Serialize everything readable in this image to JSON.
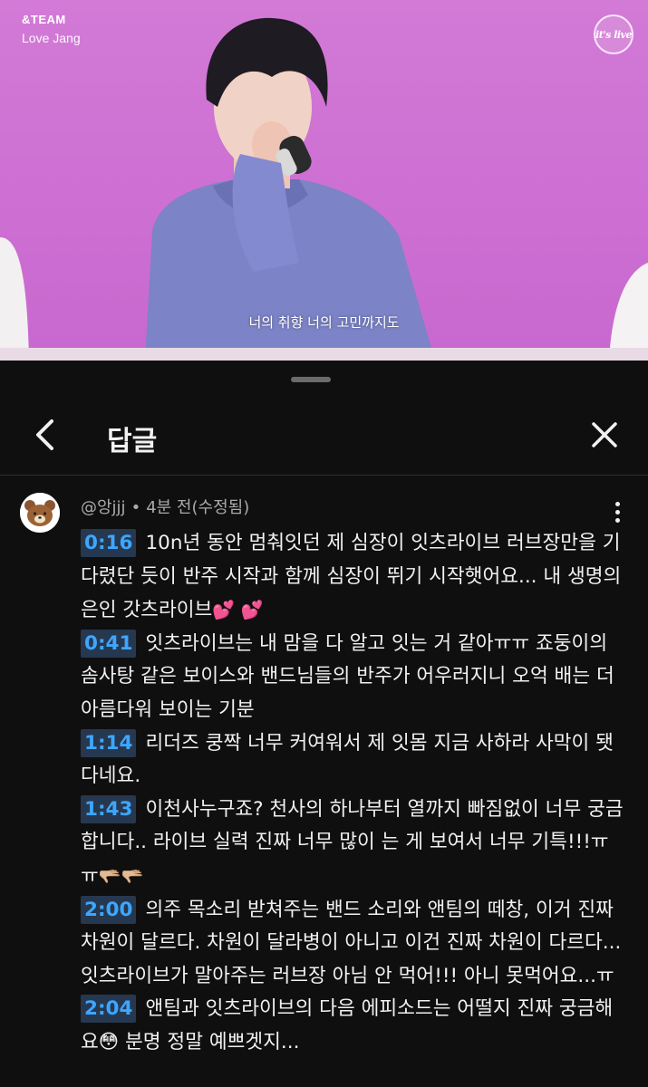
{
  "video": {
    "channel": "&TEAM",
    "song": "Love Jang",
    "logo": "it's live",
    "subtitle": "너의 취향 너의 고민까지도"
  },
  "panel": {
    "title": "답글",
    "back_icon": "chevron-left-icon",
    "close_icon": "close-icon"
  },
  "comment": {
    "author": "@앙jjj",
    "separator": "•",
    "time": "4분 전(수정됨)",
    "more_icon": "more-vert-icon",
    "paragraphs": [
      {
        "ts": "0:16",
        "text": "10n년 동안 멈춰잇던 제 심장이 잇츠라이브 러브장만을 기다렸단 듯이 반주 시작과 함께 심장이 뛰기 시작햇어요... 내 생명의 은인 갓츠라이브",
        "emoji": "💕 💕"
      },
      {
        "ts": "0:41",
        "text": "잇츠라이브는 내 맘을 다 알고 잇는 거 같아ㅠㅠ 죠둥이의 솜사탕 같은 보이스와 밴드님들의 반주가 어우러지니 오억 배는 더 아름다워 보이는 기분",
        "emoji": ""
      },
      {
        "ts": "1:14",
        "text": "리더즈 쿵짝 너무 커여워서 제 잇몸 지금 사하라 사막이 됏다네요.",
        "emoji": ""
      },
      {
        "ts": "1:43",
        "text": "이천사누구죠? 천사의 하나부터 열까지 빠짐없이 너무 궁금합니다.. 라이브 실력 진짜 너무 많이 는 게 보여서 너무 기특!!!ㅠㅠ",
        "emoji": "🫳🏼🫳🏼"
      },
      {
        "ts": "2:00",
        "text": "의주 목소리 받쳐주는 밴드 소리와 앤팀의 떼창, 이거 진짜 차원이 달르다. 차원이 달라병이 아니고 이건 진짜 차원이 다르다...잇츠라이브가 말아주는 러브장 아님 안 먹어!!! 아니 못먹어요...ㅠ",
        "emoji": ""
      },
      {
        "ts": "2:04",
        "text": "앤팀과 잇츠라이브의 다음 에피소드는 어떨지 진짜 궁금해요😳 분명 정말 예쁘겟지...",
        "emoji": ""
      }
    ]
  },
  "colors": {
    "background": "#0f0f0f",
    "timestamp_bg": "#263850",
    "timestamp_text": "#3ea6ff",
    "meta_text": "#aaaaaa"
  }
}
